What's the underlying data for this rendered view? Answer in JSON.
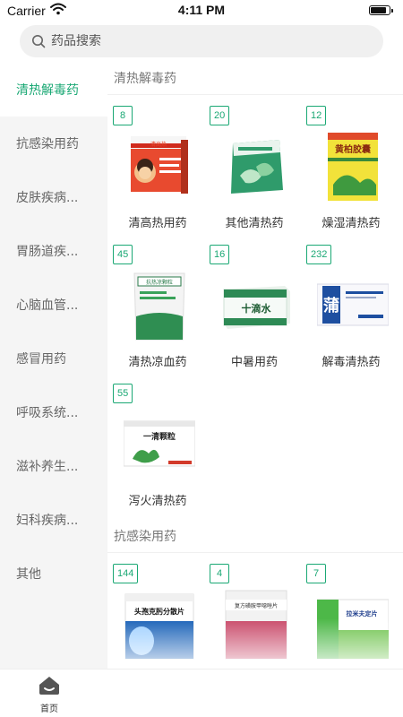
{
  "status_bar": {
    "carrier": "Carrier",
    "time": "4:11 PM"
  },
  "search": {
    "placeholder": "药品搜索"
  },
  "sidebar": {
    "items": [
      {
        "label": "清热解毒药",
        "active": true
      },
      {
        "label": "抗感染用药",
        "active": false
      },
      {
        "label": "皮肤疾病...",
        "active": false
      },
      {
        "label": "胃肠道疾...",
        "active": false
      },
      {
        "label": "心脑血管...",
        "active": false
      },
      {
        "label": "感冒用药",
        "active": false
      },
      {
        "label": "呼吸系统...",
        "active": false
      },
      {
        "label": "滋补养生...",
        "active": false
      },
      {
        "label": "妇科疾病...",
        "active": false
      },
      {
        "label": "其他",
        "active": false
      }
    ]
  },
  "sections": [
    {
      "title": "清热解毒药",
      "items": [
        {
          "count": "8",
          "name": "清高热用药"
        },
        {
          "count": "20",
          "name": "其他清热药"
        },
        {
          "count": "12",
          "name": "燥湿清热药"
        },
        {
          "count": "45",
          "name": "清热凉血药"
        },
        {
          "count": "16",
          "name": "中暑用药"
        },
        {
          "count": "232",
          "name": "解毒清热药"
        },
        {
          "count": "55",
          "name": "泻火清热药"
        }
      ]
    },
    {
      "title": "抗感染用药",
      "items": [
        {
          "count": "144",
          "name": ""
        },
        {
          "count": "4",
          "name": ""
        },
        {
          "count": "7",
          "name": ""
        }
      ]
    }
  ],
  "product_labels": {
    "p1": "清高热",
    "p3": "黄柏胶囊",
    "p4": "抗热凉颗粒",
    "p5": "十滴水",
    "p6": "蒲",
    "p7": "一清颗粒",
    "p8": "头孢克肟分散片",
    "p9": "复方磺胺甲噁唑片",
    "p10": "拉米夫定片"
  },
  "tabbar": {
    "home_label": "首页"
  },
  "colors": {
    "accent": "#1aa874",
    "sidebar_bg": "#f5f5f5"
  }
}
